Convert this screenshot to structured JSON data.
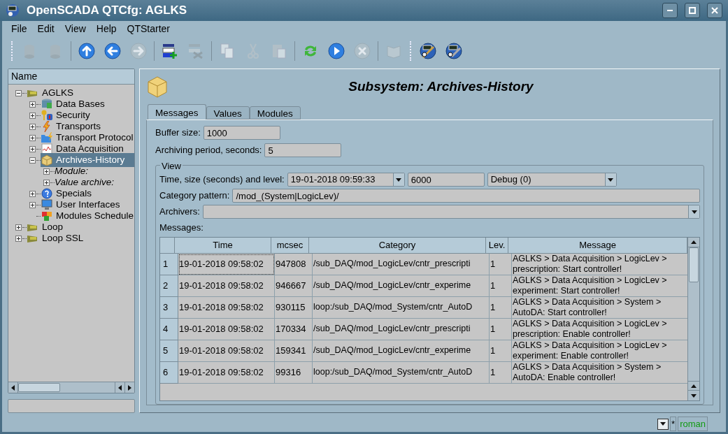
{
  "window": {
    "title": "OpenSCADA QTCfg: AGLKS"
  },
  "menu": [
    {
      "label": "File"
    },
    {
      "label": "Edit"
    },
    {
      "label": "View"
    },
    {
      "label": "Help"
    },
    {
      "label": "QTStarter"
    }
  ],
  "toolbar": [
    {
      "kind": "handle"
    },
    {
      "kind": "db-load",
      "disabled": true
    },
    {
      "kind": "db-save",
      "disabled": true
    },
    {
      "kind": "separator"
    },
    {
      "kind": "up",
      "disabled": false
    },
    {
      "kind": "back",
      "disabled": false
    },
    {
      "kind": "forward",
      "disabled": true
    },
    {
      "kind": "separator"
    },
    {
      "kind": "add",
      "disabled": false
    },
    {
      "kind": "remove",
      "disabled": true
    },
    {
      "kind": "separator"
    },
    {
      "kind": "copy",
      "disabled": true
    },
    {
      "kind": "cut",
      "disabled": true
    },
    {
      "kind": "paste",
      "disabled": true
    },
    {
      "kind": "separator"
    },
    {
      "kind": "refresh",
      "disabled": false
    },
    {
      "kind": "start",
      "disabled": false
    },
    {
      "kind": "stop",
      "disabled": true
    },
    {
      "kind": "separator"
    },
    {
      "kind": "manual",
      "disabled": true
    },
    {
      "kind": "handle"
    },
    {
      "kind": "launcher",
      "disabled": false
    },
    {
      "kind": "configurator",
      "disabled": false
    }
  ],
  "tree": {
    "header": "Name",
    "items": [
      {
        "label": "AGLKS",
        "kind": "station",
        "expanded": true,
        "selected": false,
        "children": [
          {
            "label": "Data Bases",
            "kind": "db",
            "expanded": false,
            "selected": false
          },
          {
            "label": "Security",
            "kind": "security",
            "expanded": false,
            "selected": false
          },
          {
            "label": "Transports",
            "kind": "transport",
            "expanded": false,
            "selected": false
          },
          {
            "label": "Transport Protocol",
            "kind": "protocol",
            "expanded": false,
            "selected": false
          },
          {
            "label": "Data Acquisition",
            "kind": "daq",
            "expanded": false,
            "selected": false
          },
          {
            "label": "Archives-History",
            "kind": "archive",
            "expanded": true,
            "selected": true,
            "children": [
              {
                "label": "Module:",
                "kind": "group",
                "expanded": false,
                "selected": false
              },
              {
                "label": "Value archive:",
                "kind": "group",
                "expanded": false,
                "selected": false
              }
            ]
          },
          {
            "label": "Specials",
            "kind": "special",
            "expanded": false,
            "selected": false
          },
          {
            "label": "User Interfaces",
            "kind": "ui",
            "expanded": false,
            "selected": false
          },
          {
            "label": "Modules Schedule",
            "kind": "scheduler",
            "selected": false
          }
        ]
      },
      {
        "label": "Loop",
        "kind": "station",
        "expanded": false,
        "selected": false
      },
      {
        "label": "Loop SSL",
        "kind": "station",
        "expanded": false,
        "selected": false
      }
    ]
  },
  "page": {
    "title": "Subsystem: Archives-History",
    "tabs": [
      {
        "label": "Messages",
        "selected": true
      },
      {
        "label": "Values",
        "selected": false
      },
      {
        "label": "Modules",
        "selected": false
      }
    ],
    "buffer_size": {
      "label": "Buffer size:",
      "value": "1000"
    },
    "archiving_period": {
      "label": "Archiving period, seconds:",
      "value": "5"
    },
    "view": {
      "title": "View",
      "time_size_level": {
        "label": "Time, size (seconds) and level:",
        "time": "19-01-2018 09:59:33",
        "size": "6000",
        "level": "Debug (0)"
      },
      "category_pattern": {
        "label": "Category pattern:",
        "value": "/mod_(System|LogicLev)/"
      },
      "archivers": {
        "label": "Archivers:"
      },
      "messages_label": "Messages:",
      "table": {
        "columns": [
          "Time",
          "mcsec",
          "Category",
          "Lev.",
          "Message"
        ],
        "rows": [
          {
            "index": "1",
            "time": "19-01-2018 09:58:02",
            "mcsec": "947808",
            "category": "/sub_DAQ/mod_LogicLev/cntr_prescripti",
            "level": "1",
            "message": "AGLKS > Data Acquisition > LogicLev > prescription: Start controller!",
            "selected": true
          },
          {
            "index": "2",
            "time": "19-01-2018 09:58:02",
            "mcsec": "946667",
            "category": "/sub_DAQ/mod_LogicLev/cntr_experime",
            "level": "1",
            "message": "AGLKS > Data Acquisition > LogicLev > experiment: Start controller!",
            "selected": false
          },
          {
            "index": "3",
            "time": "19-01-2018 09:58:02",
            "mcsec": "930115",
            "category": "loop:/sub_DAQ/mod_System/cntr_AutoD",
            "level": "1",
            "message": "AGLKS > Data Acquisition > System > AutoDA: Start controller!",
            "selected": false
          },
          {
            "index": "4",
            "time": "19-01-2018 09:58:02",
            "mcsec": "170334",
            "category": "/sub_DAQ/mod_LogicLev/cntr_prescripti",
            "level": "1",
            "message": "AGLKS > Data Acquisition > LogicLev > prescription: Enable controller!",
            "selected": false
          },
          {
            "index": "5",
            "time": "19-01-2018 09:58:02",
            "mcsec": "159341",
            "category": "/sub_DAQ/mod_LogicLev/cntr_experime",
            "level": "1",
            "message": "AGLKS > Data Acquisition > LogicLev > experiment: Enable controller!",
            "selected": false
          },
          {
            "index": "6",
            "time": "19-01-2018 09:58:02",
            "mcsec": "99316",
            "category": "loop:/sub_DAQ/mod_System/cntr_AutoD",
            "level": "1",
            "message": "AGLKS > Data Acquisition > System > AutoDA: Enable controller!",
            "selected": false
          }
        ]
      }
    }
  },
  "status_bar": {
    "modified": "*",
    "user": "roman"
  }
}
